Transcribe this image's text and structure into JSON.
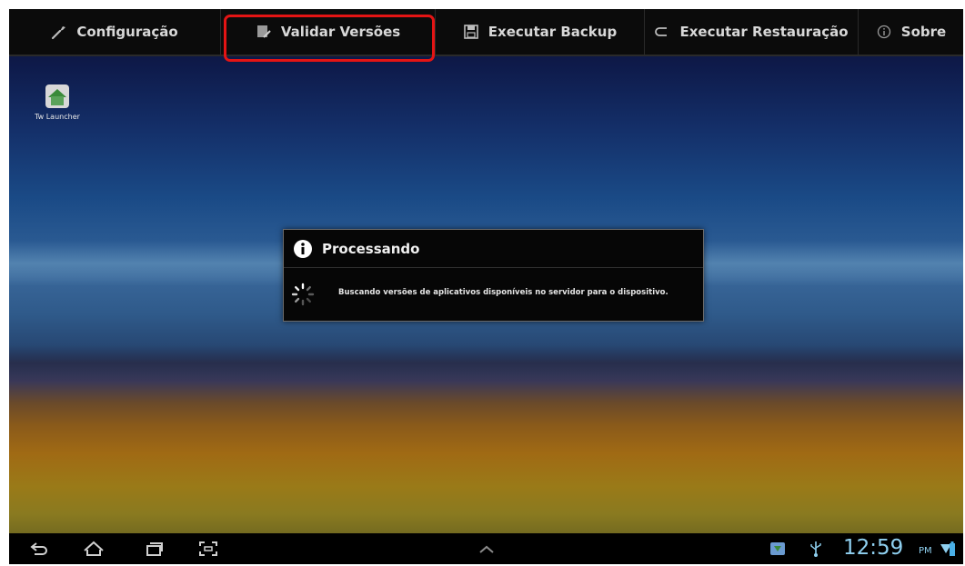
{
  "action_bar": {
    "tabs": [
      {
        "label": "Configuração",
        "icon": "wrench-icon"
      },
      {
        "label": "Validar Versões",
        "icon": "document-edit-icon",
        "selected": true
      },
      {
        "label": "Executar Backup",
        "icon": "save-icon"
      },
      {
        "label": "Executar Restauração",
        "icon": "restore-icon"
      },
      {
        "label": "Sobre",
        "icon": "info-icon"
      }
    ]
  },
  "desktop": {
    "launcher": {
      "label": "Tw Launcher",
      "icon": "home-launcher-icon"
    }
  },
  "dialog": {
    "title": "Processando",
    "message": "Buscando versões de aplicativos disponíveis no servidor para o dispositivo."
  },
  "system_bar": {
    "time": "12:59",
    "ampm": "PM",
    "nav_icons": [
      "back-icon",
      "home-icon",
      "recent-apps-icon",
      "screenshot-icon"
    ]
  },
  "colors": {
    "highlight": "#e41414",
    "clock": "#8fd0f0",
    "action_bar_bg": "#0b0b0b"
  }
}
